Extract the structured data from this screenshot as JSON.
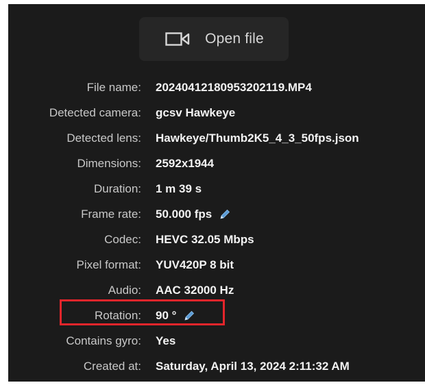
{
  "open_file": {
    "label": "Open file",
    "icon": "video-camera-icon"
  },
  "info": {
    "rows": [
      {
        "label": "File name:",
        "value": "20240412180953202119.MP4"
      },
      {
        "label": "Detected camera:",
        "value": "gcsv Hawkeye"
      },
      {
        "label": "Detected lens:",
        "value": "Hawkeye/Thumb2K5_4_3_50fps.json"
      },
      {
        "label": "Dimensions:",
        "value": "2592x1944"
      },
      {
        "label": "Duration:",
        "value": "1 m 39 s"
      },
      {
        "label": "Frame rate:",
        "value": "50.000 fps",
        "editable": true
      },
      {
        "label": "Codec:",
        "value": "HEVC 32.05 Mbps"
      },
      {
        "label": "Pixel format:",
        "value": "YUV420P 8 bit"
      },
      {
        "label": "Audio:",
        "value": "AAC 32000 Hz"
      },
      {
        "label": "Rotation:",
        "value": "90 °",
        "editable": true,
        "highlighted": true
      },
      {
        "label": "Contains gyro:",
        "value": "Yes"
      },
      {
        "label": "Created at:",
        "value": "Saturday, April 13, 2024 2:11:32 AM"
      }
    ]
  },
  "colors": {
    "panel_background": "#1b1b1b",
    "button_background": "#262626",
    "edit_icon": "#5b9bd5",
    "highlight_border": "#e5252b"
  }
}
